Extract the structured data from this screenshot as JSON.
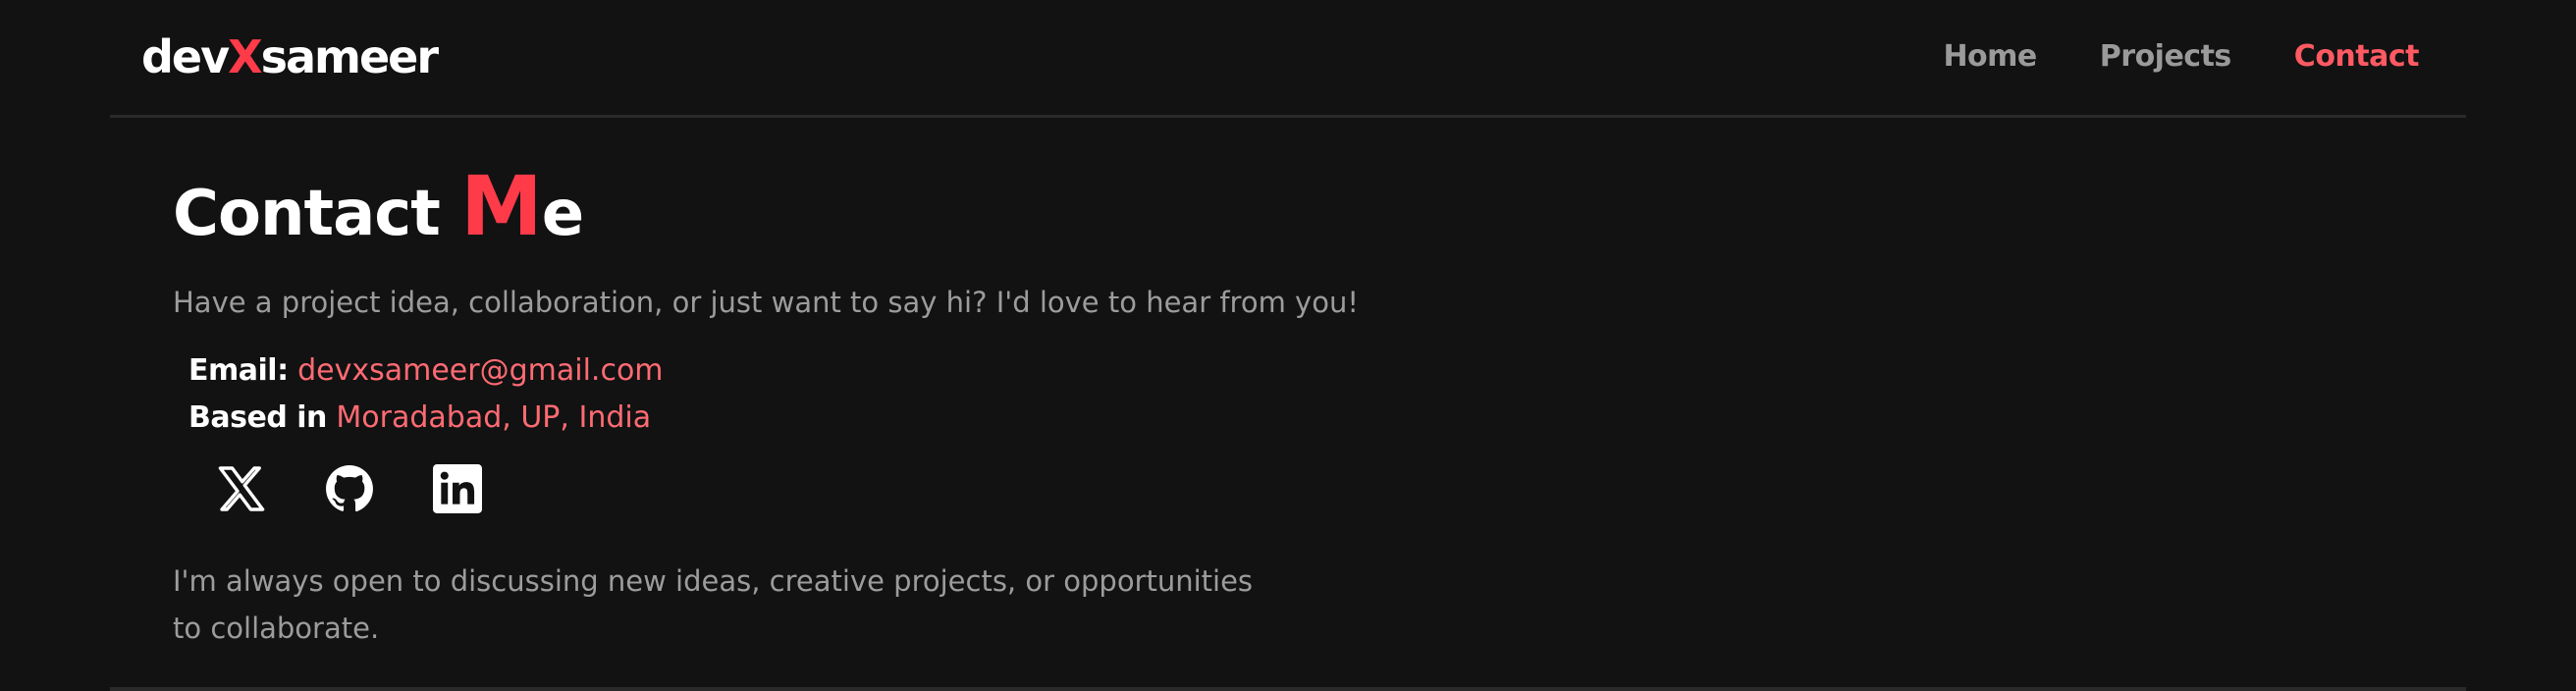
{
  "brand": {
    "prefix": "dev",
    "accent_letter": "X",
    "suffix": "sameer",
    "accent_color": "#ff3b4a"
  },
  "nav": {
    "items": [
      {
        "label": "Home",
        "active": false
      },
      {
        "label": "Projects",
        "active": false
      },
      {
        "label": "Contact",
        "active": true
      }
    ],
    "active_color": "#ff5a63"
  },
  "contact": {
    "title_prefix": "Contact ",
    "title_accent": "M",
    "title_suffix": "e",
    "intro": "Have a project idea, collaboration, or just want to say hi? I'd love to hear from you!",
    "email_label": "Email:",
    "email_value": "devxsameer@gmail.com",
    "location_label": "Based in",
    "location_value": "Moradabad, UP, India",
    "socials": [
      {
        "icon": "x-twitter-icon"
      },
      {
        "icon": "github-icon"
      },
      {
        "icon": "linkedin-icon"
      }
    ],
    "outro_line1": "I'm always open to discussing new ideas, creative projects, or opportunities",
    "outro_line2": "to collaborate."
  },
  "colors": {
    "background": "#121212",
    "muted_text": "#9c9c9c",
    "link_text": "#ff6b73"
  }
}
